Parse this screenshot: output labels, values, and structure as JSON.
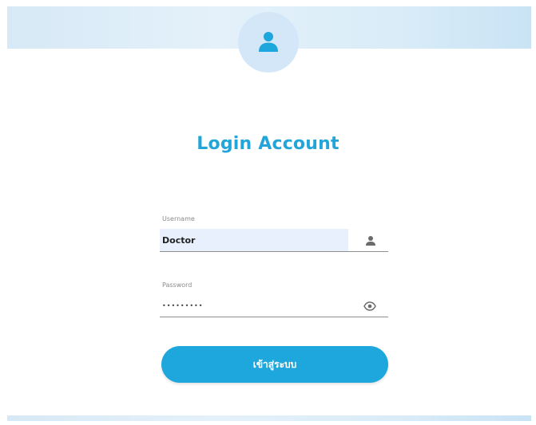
{
  "login": {
    "title": "Login Account",
    "username": {
      "label": "Username",
      "value": "Doctor"
    },
    "password": {
      "label": "Password",
      "value": "•••••••••"
    },
    "submit_label": "เข้าสู่ระบบ"
  },
  "icons": {
    "avatar": "user-icon",
    "username": "person-icon",
    "password": "eye-icon"
  },
  "colors": {
    "accent": "#1ea7dd",
    "title": "#23a5d9",
    "header_band": "#d7e9f6",
    "autofill_bg": "#e8f0fe"
  }
}
